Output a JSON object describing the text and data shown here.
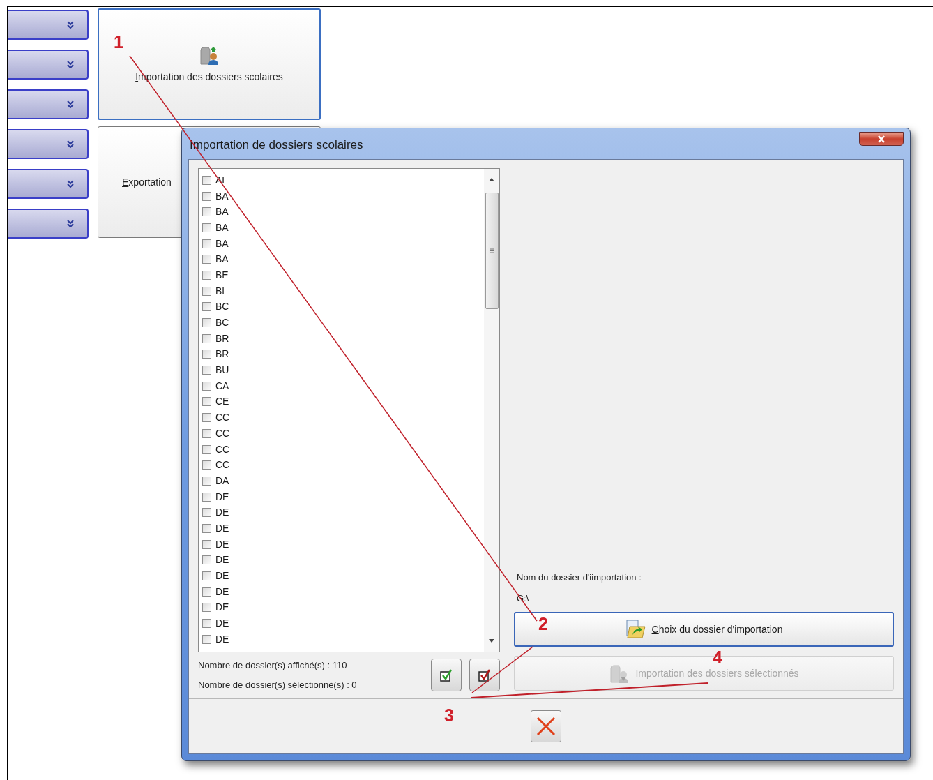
{
  "sidebar": {
    "sections": [
      {
        "expanded": false
      },
      {
        "expanded": false
      },
      {
        "expanded": false
      },
      {
        "expanded": false
      },
      {
        "expanded": false
      },
      {
        "expanded": false
      }
    ]
  },
  "tiles": [
    {
      "label": "Importation des dossiers scolaires",
      "selected": true,
      "kind": "icon"
    },
    {
      "label": "Exportation",
      "selected": false,
      "kind": "plain"
    }
  ],
  "dialog": {
    "title": "Importation de dossiers scolaires",
    "items": [
      {
        "label": "AL",
        "checked": false
      },
      {
        "label": "BA",
        "checked": false
      },
      {
        "label": "BA",
        "checked": false
      },
      {
        "label": "BA",
        "checked": false
      },
      {
        "label": "BA",
        "checked": false
      },
      {
        "label": "BA",
        "checked": false
      },
      {
        "label": "BE",
        "checked": false
      },
      {
        "label": "BL",
        "checked": false
      },
      {
        "label": "BC",
        "checked": false
      },
      {
        "label": "BC",
        "checked": false
      },
      {
        "label": "BR",
        "checked": false
      },
      {
        "label": "BR",
        "checked": false
      },
      {
        "label": "BU",
        "checked": false
      },
      {
        "label": "CA",
        "checked": false
      },
      {
        "label": "CE",
        "checked": false
      },
      {
        "label": "CC",
        "checked": false
      },
      {
        "label": "CC",
        "checked": false
      },
      {
        "label": "CC",
        "checked": false
      },
      {
        "label": "CC",
        "checked": false
      },
      {
        "label": "DA",
        "checked": false
      },
      {
        "label": "DE",
        "checked": false
      },
      {
        "label": "DE",
        "checked": false
      },
      {
        "label": "DE",
        "checked": false
      },
      {
        "label": "DE",
        "checked": false
      },
      {
        "label": "DE",
        "checked": false
      },
      {
        "label": "DE",
        "checked": false
      },
      {
        "label": "DE",
        "checked": false
      },
      {
        "label": "DE",
        "checked": false
      },
      {
        "label": "DE",
        "checked": false
      },
      {
        "label": "DE",
        "checked": false
      }
    ],
    "count_displayed": "Nombre de dossier(s) affiché(s) : 110",
    "count_selected": "Nombre de dossier(s) sélectionné(s) : 0",
    "folder_label": "Nom du dossier d'iimportation :",
    "folder_value": "G:\\",
    "buttons": [
      {
        "kind": "choose",
        "label": "Choix du dossier d'importation",
        "disabled": false
      },
      {
        "kind": "import",
        "label": "Importation des dossiers sélectionnés",
        "disabled": true
      }
    ]
  },
  "annotations": [
    {
      "label": "1"
    },
    {
      "label": "2"
    },
    {
      "label": "3"
    },
    {
      "label": "4"
    }
  ]
}
